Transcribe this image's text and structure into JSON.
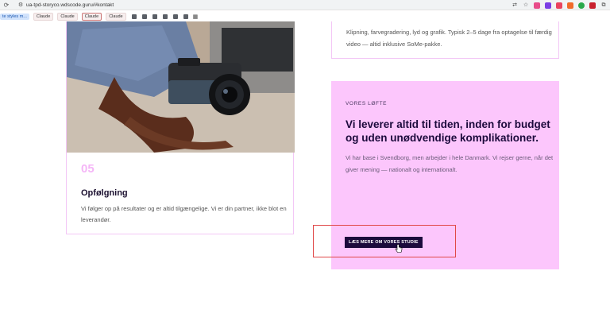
{
  "browser": {
    "url": "ua-tpd-storyco.wdscode.guru/#kontakt"
  },
  "bookmarks": {
    "first": "te styles m...",
    "chips": [
      "Claude",
      "Claude",
      "Claude",
      "Claude"
    ]
  },
  "services": {
    "card4_body": "Klipning, farvegradering, lyd og grafik. Typisk 2–5 dage fra optagelse til færdig video — altid inklusive SoMe-pakke.",
    "card5": {
      "number": "05",
      "title": "Opfølgning",
      "body": "Vi følger op på resultater og er altid tilgængelige. Vi er din partner, ikke blot en leverandør."
    }
  },
  "promise": {
    "label": "VORES LØFTE",
    "heading": "Vi leverer altid til tiden, inden for budget og uden unødvendige komplikationer.",
    "body": "Vi har base i Svendborg, men arbejder i hele Danmark. Vi rejser gerne, når det giver mening — nationalt og internationalt.",
    "cta_label": "LÆS MERE OM VORES STUDIE"
  },
  "colors": {
    "accent_pink": "#fcc6fc",
    "dark_purple": "#1c0a3c",
    "highlight_red": "#e04848"
  }
}
